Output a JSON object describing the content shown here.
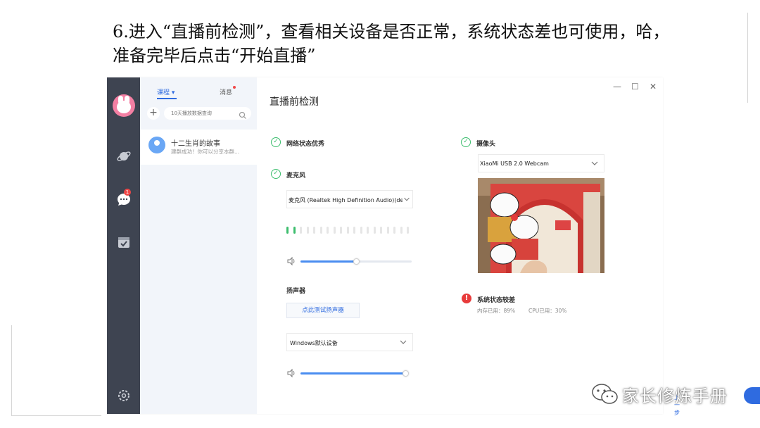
{
  "slide": {
    "caption_line1": "6.进入“直播前检测”，查看相关设备是否正常，系统状态差也可使用，哈，",
    "caption_line2": "准备完毕后点击“开始直播”"
  },
  "sidebar": {
    "badge_count": "1",
    "icons": [
      "planet-icon",
      "chat-icon",
      "calendar-check-icon",
      "settings-icon"
    ]
  },
  "list_panel": {
    "tab_course": "课程 ▾",
    "tab_messages": "消息",
    "search_placeholder": "10天播放数据查询",
    "courses": [
      {
        "title": "十二生肖的故事",
        "subtitle": "建群成功！你可以分享本群..."
      }
    ]
  },
  "main": {
    "title": "直播前检测",
    "network": {
      "label": "网络状态优秀",
      "status": "ok"
    },
    "microphone": {
      "label": "麦克风",
      "selected_device": "麦克风 (Realtek High Definition Audio)(de",
      "input_level_segments_on": 2,
      "input_level_segments_total": 19,
      "volume_fraction": 0.5
    },
    "speaker": {
      "label": "扬声器",
      "test_button": "点此测试扬声器",
      "selected_device": "Windows默认设备",
      "volume_fraction": 0.98
    },
    "camera": {
      "label": "摄像头",
      "selected_device": "XiaoMi USB 2.0 Webcam"
    },
    "system": {
      "label": "系统状态较差",
      "memory": "内存已用：89%",
      "cpu": "CPU已用：30%"
    },
    "footer": {
      "prev": "上一步"
    }
  },
  "window_controls": {
    "minimize": "—",
    "maximize": "☐",
    "close": "✕"
  },
  "watermark": {
    "text": "家长修炼手册"
  },
  "colors": {
    "accent": "#2f6be0",
    "ok_green": "#3dbe6e",
    "warn_red": "#e83b3b",
    "sidebar_bg": "#3e4451"
  }
}
